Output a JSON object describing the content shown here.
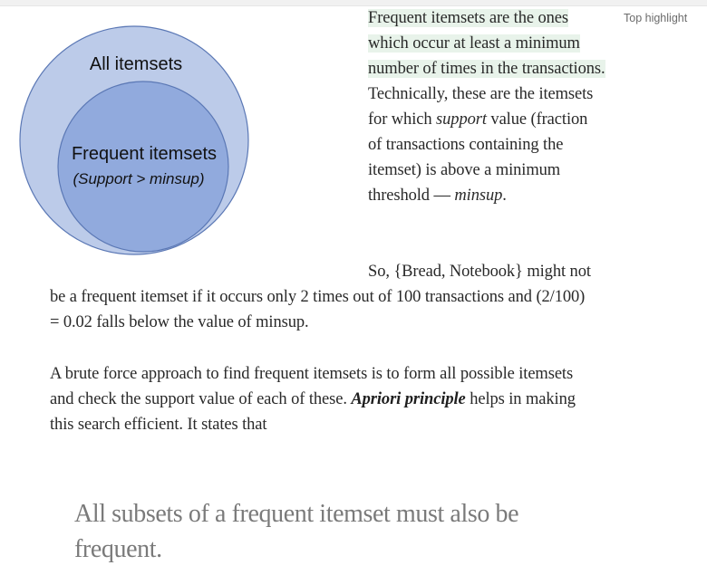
{
  "highlight_note": "Top highlight",
  "venn": {
    "outer_label": "All itemsets",
    "inner_label": "Frequent itemsets",
    "inner_sublabel": "(Support > minsup)",
    "colors": {
      "outer_fill": "#bccbe9",
      "inner_fill": "#91aadd",
      "stroke": "#5b78b5"
    }
  },
  "side_paragraph": {
    "highlighted": "Frequent itemsets are the ones which occur at least a minimum number of times in the transactions.",
    "part1": " Technically, these are the itemsets for which ",
    "support_word": "support",
    "part2": " value (fraction of transactions containing the itemset) is above a minimum threshold — ",
    "minsup_word": "minsup",
    "part3": "."
  },
  "paragraph2": "So, {Bread, Notebook} might not be a frequent itemset if it occurs only 2 times out of 100 transactions and (2/100) = 0.02 falls below the value of minsup.",
  "paragraph3": {
    "part1": "A brute force approach to find frequent itemsets is to form all possible itemsets and check the support value of each of these. ",
    "emphasis": "Apriori principle",
    "part2": " helps in making this search efficient. It states that"
  },
  "pull_quote": "All subsets of a frequent itemset must also be frequent."
}
